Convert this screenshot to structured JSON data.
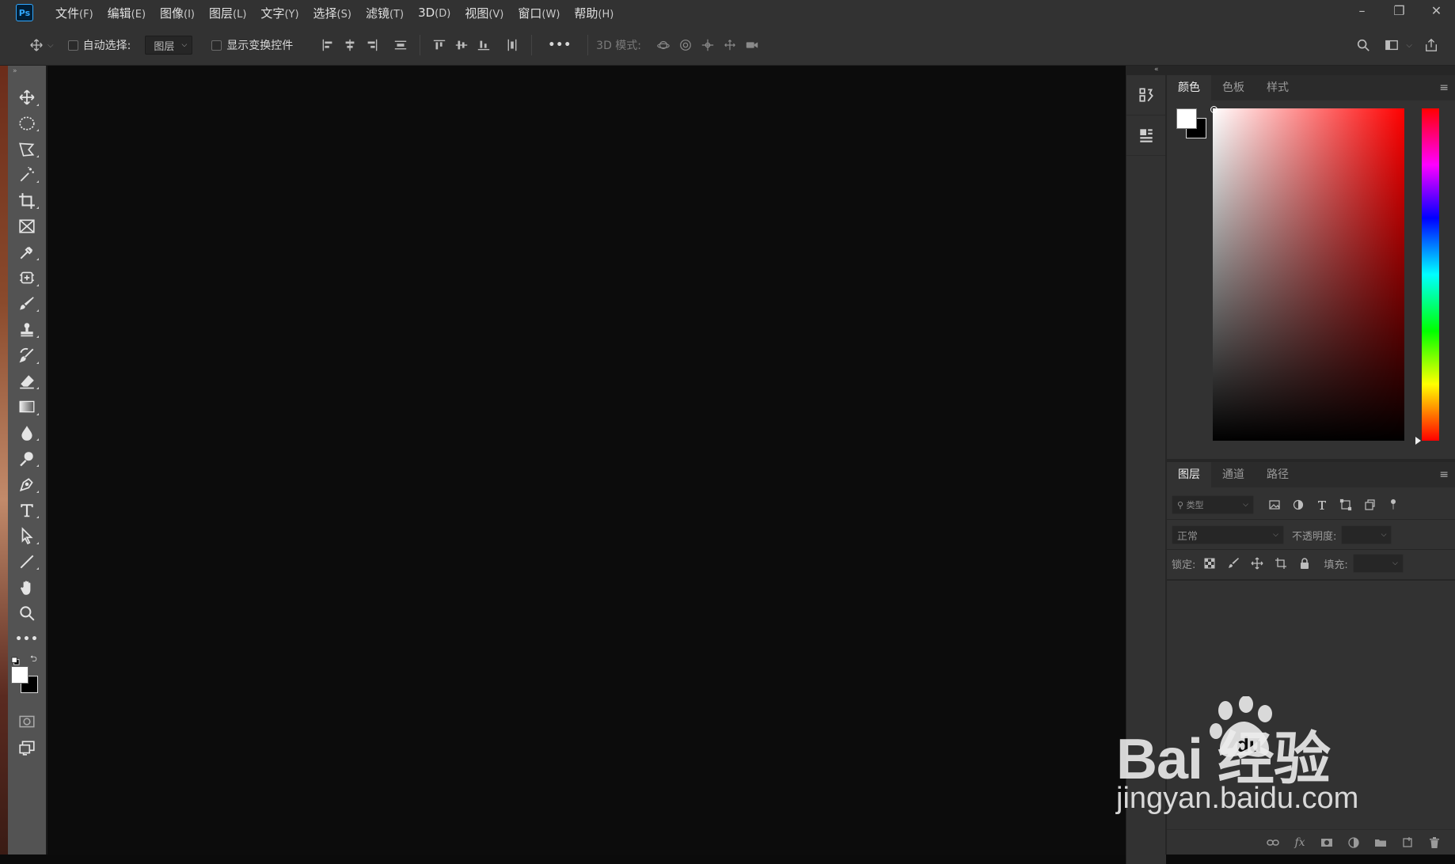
{
  "app": {
    "logo_text": "Ps",
    "menu": [
      {
        "label": "文件",
        "key": "(F)"
      },
      {
        "label": "编辑",
        "key": "(E)"
      },
      {
        "label": "图像",
        "key": "(I)"
      },
      {
        "label": "图层",
        "key": "(L)"
      },
      {
        "label": "文字",
        "key": "(Y)"
      },
      {
        "label": "选择",
        "key": "(S)"
      },
      {
        "label": "滤镜",
        "key": "(T)"
      },
      {
        "label": "3D",
        "key": "(D)"
      },
      {
        "label": "视图",
        "key": "(V)"
      },
      {
        "label": "窗口",
        "key": "(W)"
      },
      {
        "label": "帮助",
        "key": "(H)"
      }
    ],
    "window_controls": {
      "minimize": "–",
      "restore": "❐",
      "close": "✕"
    }
  },
  "options_bar": {
    "auto_select_label": "自动选择:",
    "auto_select_value": "图层",
    "show_transform_label": "显示变换控件",
    "more_label": "•••",
    "mode_3d_label": "3D 模式:"
  },
  "toolbar": {
    "collapse": "»",
    "more_label": "•••"
  },
  "panels": {
    "collapse_left": "«",
    "collapse_right": "»",
    "color_tabs": [
      "颜色",
      "色板",
      "样式"
    ],
    "layers_tabs": [
      "图层",
      "通道",
      "路径"
    ],
    "menu_glyph": "≡",
    "filter_placeholder": "类型",
    "blend_mode": "正常",
    "opacity_label": "不透明度:",
    "lock_label": "锁定:",
    "fill_label": "填充:",
    "footer_fx": "fx"
  },
  "watermark": {
    "brand": "Bai  经验",
    "url": "jingyan.baidu.com"
  },
  "colors": {
    "foreground": "#ffffff",
    "background": "#000000",
    "accent": "#31a8ff"
  }
}
